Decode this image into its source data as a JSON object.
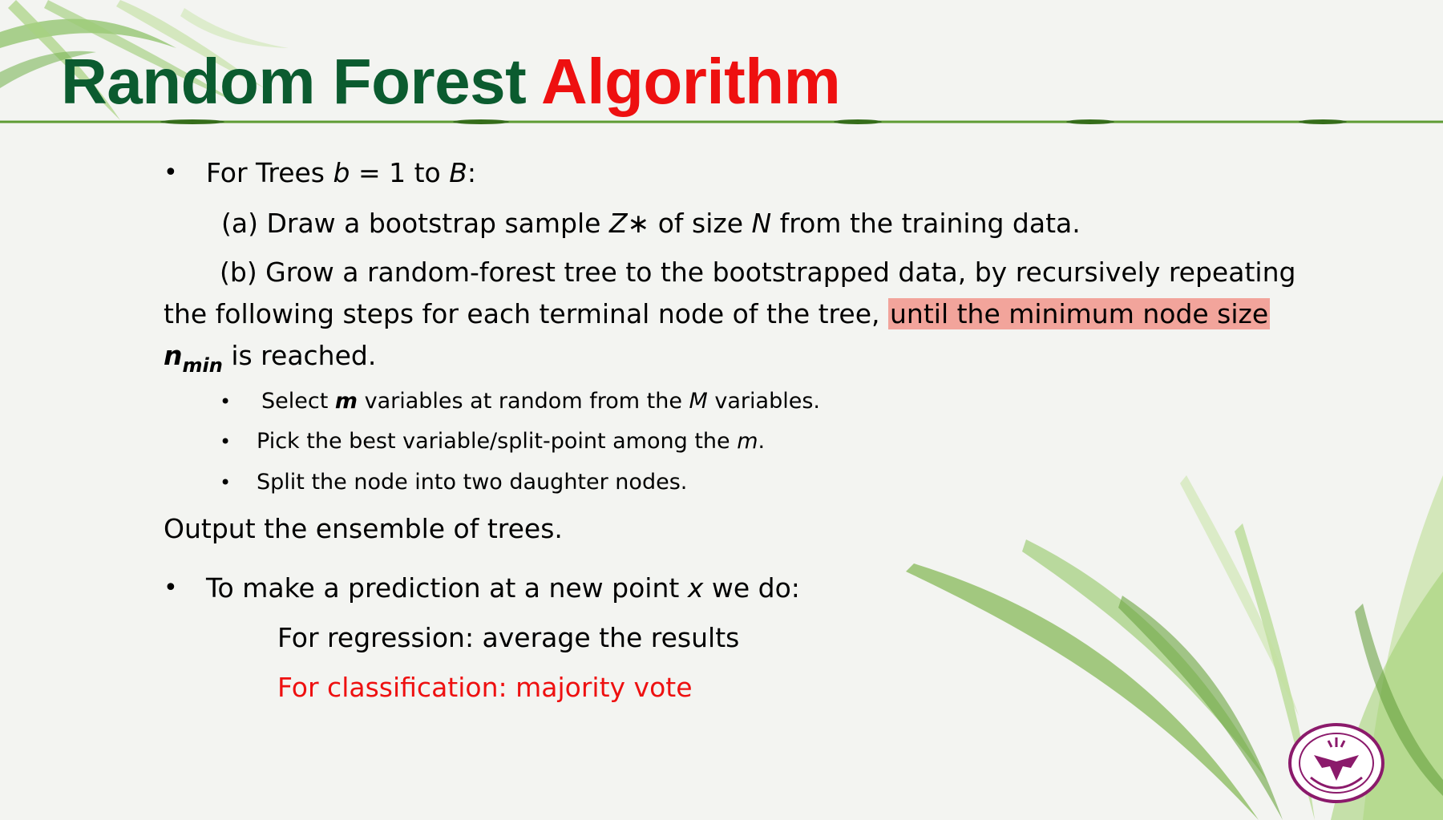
{
  "title": {
    "part1": "Random Forest",
    "part2": "Algorithm"
  },
  "content": {
    "bullet1": {
      "prefix": "For Trees ",
      "var_b": "b",
      "mid": " = 1 to ",
      "var_B": "B",
      "suffix": ":"
    },
    "step_a": {
      "prefix": "(a) Draw a bootstrap sample ",
      "var_z": "Z∗",
      "mid": " of size ",
      "var_n": "N",
      "suffix": " from the training data."
    },
    "step_b": {
      "line1": "(b) Grow a random-forest tree  to the bootstrapped data, by recursively repeating",
      "line2_prefix": "the following steps for each terminal node of the tree, ",
      "line2_highlight": "until the minimum node size",
      "line3_n": "n",
      "line3_sub": "min",
      "line3_suffix": " is reached."
    },
    "sub_bullets": {
      "s1_prefix": "Select ",
      "s1_m": "m",
      "s1_mid": " variables at random from the ",
      "s1_M": "M",
      "s1_suffix": " variables.",
      "s2_prefix": "Pick the best variable/split-point among the ",
      "s2_m": "m",
      "s2_suffix": ".",
      "s3": "Split the node into two daughter nodes."
    },
    "output": "Output the ensemble of trees.",
    "bullet2": {
      "prefix": "To make a prediction at a new point ",
      "var_x": "x",
      "suffix": " we do:"
    },
    "regression": "For regression: average the results",
    "classification": "For classification: majority vote"
  },
  "colors": {
    "title_green": "#0b5b2f",
    "title_red": "#ee1010",
    "highlight": "#f2a49b",
    "classification_red": "#ee1010"
  },
  "icons": {
    "logo": "zhejiang-university-seal"
  }
}
